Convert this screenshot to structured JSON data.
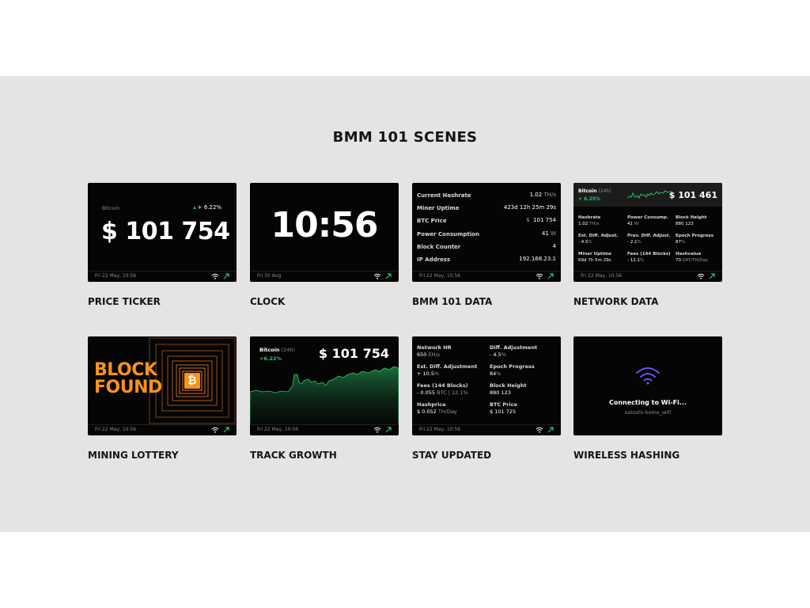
{
  "page": {
    "title": "BMM 101 SCENES"
  },
  "colors": {
    "band": "#e5e3e4",
    "screen": "#050505",
    "accent_green": "#2ec66a",
    "accent_orange": "#f7931a"
  },
  "icons": {
    "wifi": "wifi-icon",
    "trend": "trend-up-icon",
    "bitcoin": "bitcoin-icon"
  },
  "scenes": [
    {
      "caption": "PRICE TICKER",
      "footer_date": "Fri 22 May, 10:56",
      "coin": "Bitcoin",
      "change": "+ 6.22%",
      "price": "$ 101 754"
    },
    {
      "caption": "CLOCK",
      "footer_date": "Fri 30 Aug",
      "time": "10:56"
    },
    {
      "caption": "BMM 101 DATA",
      "footer_date": "Fri 22 May, 10:56",
      "rows": [
        {
          "label": "Current Hashrate",
          "value": "1.02",
          "unit": "TH/s"
        },
        {
          "label": "Miner Uptime",
          "value": "423d 12h 25m 29s",
          "unit": ""
        },
        {
          "label": "BTC Price",
          "unit_prefix": "$",
          "value": "101 754",
          "unit": ""
        },
        {
          "label": "Power Consumption",
          "value": "41",
          "unit": "W"
        },
        {
          "label": "Block Counter",
          "value": "4",
          "unit": ""
        },
        {
          "label": "IP Address",
          "value": "192.168.23.1",
          "unit": ""
        }
      ]
    },
    {
      "caption": "NETWORK DATA",
      "footer_date": "Fri 22 May, 10:56",
      "coin": "Bitcoin",
      "period": "(24h)",
      "change": "+ 6.25%",
      "price": "$ 101 461",
      "cells": [
        {
          "label": "Hashrate",
          "value": "1.02",
          "unit": "TH/s"
        },
        {
          "label": "Power Consump.",
          "value": "41",
          "unit": "W"
        },
        {
          "label": "Block Height",
          "value": "880 123",
          "unit": ""
        },
        {
          "label": "Est. Diff. Adjust.",
          "value": "- 4.5",
          "unit": "%"
        },
        {
          "label": "Prev. Diff. Adjust.",
          "value": "- 2.1",
          "unit": "%"
        },
        {
          "label": "Epoch Progress",
          "value": "87",
          "unit": "%"
        },
        {
          "label": "Miner Uptime",
          "value": "69d 7h 5m 29s",
          "unit": ""
        },
        {
          "label": "Fees (144 Blocks)",
          "value": "- 12.1",
          "unit": "%"
        },
        {
          "label": "Hashvalue",
          "value": "70",
          "unit": "SAT/TH/Day"
        }
      ]
    },
    {
      "caption": "MINING LOTTERY",
      "footer_date": "Fri 22 May, 10:56",
      "line1": "BLOCK",
      "line2": "FOUND",
      "symbol": "₿"
    },
    {
      "caption": "TRACK GROWTH",
      "footer_date": "Fri 22 May, 10:56",
      "coin": "Bitcoin",
      "period": "(24h)",
      "change": "+6.22%",
      "price": "$ 101 754"
    },
    {
      "caption": "STAY UPDATED",
      "footer_date": "Fri 22 May, 10:56",
      "cells": [
        {
          "label": "Network HR",
          "value": "650",
          "unit": "EH/s"
        },
        {
          "label": "Diff. Adjustment",
          "value": "- 4.5",
          "unit": "%"
        },
        {
          "label": "Est. Diff. Adjustment",
          "value": "+ 10.5",
          "unit": "%"
        },
        {
          "label": "Epoch Progress",
          "value": "84",
          "unit": "%"
        },
        {
          "label": "Fees (144 Blocks)",
          "value": "- 0.055",
          "unit": "BTC | 12.1%"
        },
        {
          "label": "Block Height",
          "value": "880 123",
          "unit": ""
        },
        {
          "label": "Hashprice",
          "value": "$ 0.052",
          "unit": "TH/Day"
        },
        {
          "label": "BTC Price",
          "value": "$ 101 725",
          "unit": ""
        }
      ]
    },
    {
      "caption": "WIRELESS HASHING",
      "status": "Connecting to Wi-Fi...",
      "ssid": "satoshi-home_wifi"
    }
  ]
}
